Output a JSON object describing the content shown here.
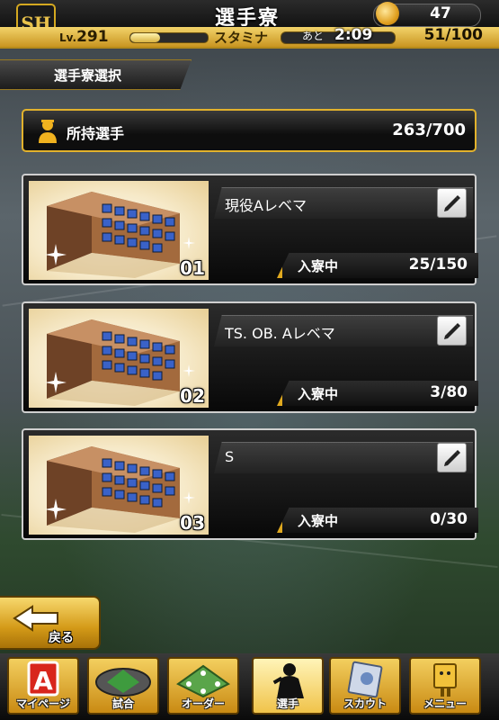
{
  "header": {
    "logo_text": "SH",
    "title": "選手寮",
    "gem_count": "47",
    "level_prefix": "Lv.",
    "level": "291",
    "stamina_label": "スタミナ",
    "recover_prefix": "あと",
    "recover_time": "2:09",
    "stamina": "51/100",
    "exp_fraction": 0.38,
    "stamina_fraction": 0.51
  },
  "section_title": "選手寮選択",
  "owned": {
    "label": "所持選手",
    "value": "263/700"
  },
  "dorms": [
    {
      "number": "01",
      "name": "現役Aレベマ",
      "status": "入寮中",
      "count": "25/150"
    },
    {
      "number": "02",
      "name": "TS. OB. Aレベマ",
      "status": "入寮中",
      "count": "3/80"
    },
    {
      "number": "03",
      "name": "S",
      "status": "入寮中",
      "count": "0/30"
    }
  ],
  "back_label": "戻る",
  "nav": [
    {
      "label": "マイページ",
      "icon": "mypage-icon"
    },
    {
      "label": "試合",
      "icon": "stadium-icon"
    },
    {
      "label": "オーダー",
      "icon": "order-icon"
    },
    {
      "label": "選手",
      "icon": "player-icon"
    },
    {
      "label": "スカウト",
      "icon": "scout-icon"
    },
    {
      "label": "メニュー",
      "icon": "menu-icon"
    }
  ],
  "colors": {
    "accent_gold": "#e2b22c",
    "frame_white": "#cfcfcf"
  }
}
